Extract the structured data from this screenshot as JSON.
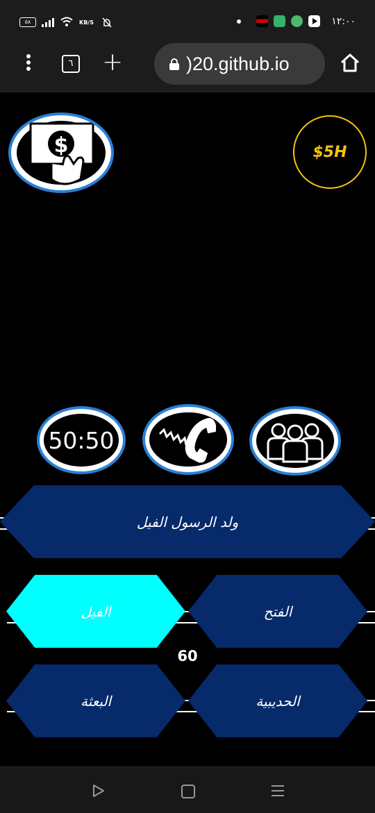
{
  "status_bar": {
    "battery": "٥٨",
    "net_speed": "KB/S",
    "time": "١٢:٠٠"
  },
  "browser": {
    "tab_count": "٦",
    "url": ")20.github.io"
  },
  "game": {
    "prize": "$5H",
    "lifelines": {
      "fifty_fifty": "50:50",
      "phone": "phone-a-friend-icon",
      "audience": "ask-audience-icon"
    },
    "question": "ولد الرسول الفيل",
    "answers": [
      {
        "text": "الفيل",
        "selected": true
      },
      {
        "text": "الفتح",
        "selected": false
      },
      {
        "text": "البعثة",
        "selected": false
      },
      {
        "text": "الحديبية",
        "selected": false
      }
    ],
    "timer": "60",
    "colors": {
      "hex_bg": "#062a6a",
      "selected_bg": "#00ffff",
      "lifeline_ring": "#2a7fd6",
      "prize_gold": "#f4c20d"
    }
  }
}
